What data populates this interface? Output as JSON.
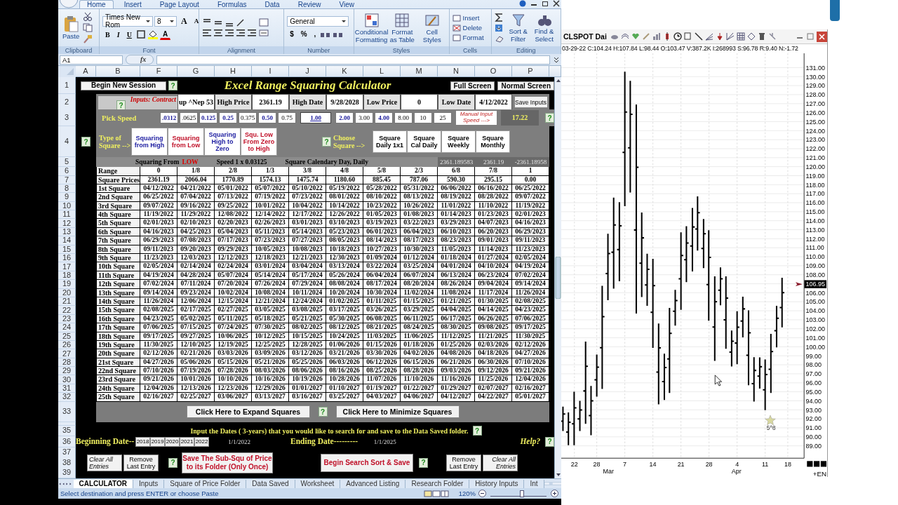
{
  "ribbon": {
    "tabs": [
      {
        "label": "Home",
        "selected": true
      },
      {
        "label": "Insert",
        "selected": false
      },
      {
        "label": "Page Layout",
        "selected": false
      },
      {
        "label": "Formulas",
        "selected": false
      },
      {
        "label": "Data",
        "selected": false
      },
      {
        "label": "Review",
        "selected": false
      },
      {
        "label": "View",
        "selected": false
      }
    ],
    "paste": "Paste",
    "font_name": "Times New Rom",
    "font_size": "8",
    "size_buttons": [
      "A",
      "A"
    ],
    "format_buttons": [
      "B",
      "I",
      "U"
    ],
    "font_color": "A",
    "number_format": "General",
    "number_buttons": [
      "$",
      "%",
      ","
    ],
    "styles": [
      "Conditional Formatting",
      "Format as Table",
      "Cell Styles"
    ],
    "cells": [
      "Insert",
      "Delete",
      "Format"
    ],
    "editing": [
      "Sort & Filter",
      "Find & Select"
    ],
    "groups": [
      "Clipboard",
      "Font",
      "Alignment",
      "Number",
      "Styles",
      "Cells",
      "Editing"
    ]
  },
  "name_box": "A1",
  "formula_label": "fx",
  "columns": [
    "A",
    "B",
    "F",
    "G",
    "H",
    "I",
    "J",
    "K",
    "L",
    "M",
    "N",
    "O",
    "P"
  ],
  "row_numbers": [
    "1",
    "2",
    "3",
    "4",
    "5",
    "6",
    "7",
    "8",
    "9",
    "10",
    "11",
    "12",
    "13",
    "14",
    "15",
    "16",
    "17",
    "18",
    "19",
    "20",
    "21",
    "22",
    "23",
    "24",
    "25",
    "26",
    "27",
    "28",
    "29",
    "30",
    "31",
    "32",
    "33",
    "35",
    "36",
    "37",
    "38",
    "39"
  ],
  "calculator": {
    "begin_button": "Begin New Session",
    "begin_help": "?",
    "title": "Excel Range Squaring Calculator",
    "screen_buttons": [
      "Full Screen",
      "Normal Screen"
    ],
    "inputs_label": "Inputs: Contract",
    "inputs_help": "?",
    "contract": "up ^Nep 53",
    "inputs": [
      {
        "label": "High Price",
        "value": "2361.19"
      },
      {
        "label": "High Date",
        "value": "9/28/2028"
      },
      {
        "label": "Low Price",
        "value": "0"
      },
      {
        "label": "Low Date",
        "value": "4/12/2022"
      }
    ],
    "save_inputs": "Save Inputs",
    "pick_speed_label": "Pick Speed",
    "speeds": [
      {
        "value": ".0312",
        "highlight": true,
        "selected": false
      },
      {
        "value": ".0625",
        "highlight": false,
        "selected": false
      },
      {
        "value": "0.125",
        "highlight": true,
        "selected": false
      },
      {
        "value": "0.25",
        "highlight": true,
        "selected": false
      },
      {
        "value": "0.375",
        "highlight": false,
        "selected": false
      },
      {
        "value": "0.50",
        "highlight": true,
        "selected": false
      },
      {
        "value": "0.75",
        "highlight": false,
        "selected": false
      },
      {
        "value": "1.00",
        "highlight": true,
        "selected": true
      },
      {
        "value": "2.00",
        "highlight": true,
        "selected": false
      },
      {
        "value": "3.00",
        "highlight": false,
        "selected": false
      },
      {
        "value": "4.00",
        "highlight": true,
        "selected": false
      },
      {
        "value": "8.00",
        "highlight": false,
        "selected": false
      },
      {
        "value": "10",
        "highlight": false,
        "selected": false
      },
      {
        "value": "25",
        "highlight": false,
        "selected": false
      }
    ],
    "manual_speed": "Manual Input Speed --->",
    "speed_value": "17.22",
    "speed_help": "?",
    "type_help": "?",
    "type_label": "Type of Square -->",
    "square_types": [
      {
        "label": "Squaring from High",
        "color": "#1c1ca0"
      },
      {
        "label": "Squaring from Low",
        "color": "#c01028"
      },
      {
        "label": "Squaring High to Zero",
        "color": "#1c1ca0"
      },
      {
        "label": "Squ. Low From Zero to High",
        "color": "#c01028"
      }
    ],
    "choose_help": "?",
    "choose_label": "Choose Square -->",
    "square_periods": [
      "Square Daily 1x1",
      "Square Cal Daily",
      "Square Weekly",
      "Square Monthly"
    ],
    "squaring_from_label": "Squaring From",
    "squaring_from": "LOW",
    "speed_text": "Speed 1 x 0.03125",
    "square_mode": "Square Calendary Day, Daily",
    "summary_values": [
      "2361.189583",
      "2361.19",
      "-2361.18958"
    ],
    "table": {
      "range_label": "Range",
      "ranges": [
        "0",
        "1/8",
        "2/8",
        "1/3",
        "3/8",
        "4/8",
        "5/8",
        "2/3",
        "6/8",
        "7/8",
        "1"
      ],
      "prices_label": "Square Prices",
      "prices": [
        "2361.19",
        "2066.04",
        "1770.89",
        "1574.13",
        "1475.74",
        "1180.60",
        "885.45",
        "787.06",
        "590.30",
        "295.15",
        "0.00"
      ],
      "rows": [
        {
          "label": "1st Square",
          "dates": [
            "04/12/2022",
            "04/21/2022",
            "05/01/2022",
            "05/07/2022",
            "05/10/2022",
            "05/19/2022",
            "05/28/2022",
            "05/31/2022",
            "06/06/2022",
            "06/16/2022",
            "06/25/2022"
          ]
        },
        {
          "label": "2nd Square",
          "dates": [
            "06/25/2022",
            "07/04/2022",
            "07/13/2022",
            "07/19/2022",
            "07/23/2022",
            "08/01/2022",
            "08/10/2022",
            "08/13/2022",
            "08/19/2022",
            "08/28/2022",
            "09/07/2022"
          ]
        },
        {
          "label": "3rd Square",
          "dates": [
            "09/07/2022",
            "09/16/2022",
            "09/25/2022",
            "10/01/2022",
            "10/04/2022",
            "10/14/2022",
            "10/23/2022",
            "10/26/2022",
            "11/01/2022",
            "11/10/2022",
            "11/19/2022"
          ]
        },
        {
          "label": "4th Square",
          "dates": [
            "11/19/2022",
            "11/29/2022",
            "12/08/2022",
            "12/14/2022",
            "12/17/2022",
            "12/26/2022",
            "01/05/2023",
            "01/08/2023",
            "01/14/2023",
            "01/23/2023",
            "02/01/2023"
          ]
        },
        {
          "label": "5th Square",
          "dates": [
            "02/01/2023",
            "02/10/2023",
            "02/20/2023",
            "02/26/2023",
            "03/01/2023",
            "03/10/2023",
            "03/19/2023",
            "03/22/2023",
            "03/29/2023",
            "04/07/2023",
            "04/16/2023"
          ]
        },
        {
          "label": "6th Square",
          "dates": [
            "04/16/2023",
            "04/25/2023",
            "05/04/2023",
            "05/11/2023",
            "05/14/2023",
            "05/23/2023",
            "06/01/2023",
            "06/04/2023",
            "06/10/2023",
            "06/20/2023",
            "06/29/2023"
          ]
        },
        {
          "label": "7th Square",
          "dates": [
            "06/29/2023",
            "07/08/2023",
            "07/17/2023",
            "07/23/2023",
            "07/27/2023",
            "08/05/2023",
            "08/14/2023",
            "08/17/2023",
            "08/23/2023",
            "09/01/2023",
            "09/11/2023"
          ]
        },
        {
          "label": "8th Square",
          "dates": [
            "09/11/2023",
            "09/20/2023",
            "09/29/2023",
            "10/05/2023",
            "10/08/2023",
            "10/18/2023",
            "10/27/2023",
            "10/30/2023",
            "11/05/2023",
            "11/14/2023",
            "11/23/2023"
          ]
        },
        {
          "label": "9th Square",
          "dates": [
            "11/23/2023",
            "12/03/2023",
            "12/12/2023",
            "12/18/2023",
            "12/21/2023",
            "12/30/2023",
            "01/09/2024",
            "01/12/2024",
            "01/18/2024",
            "01/27/2024",
            "02/05/2024"
          ]
        },
        {
          "label": "10th Square",
          "dates": [
            "02/05/2024",
            "02/14/2024",
            "02/24/2024",
            "03/01/2024",
            "03/04/2024",
            "03/13/2024",
            "03/22/2024",
            "03/25/2024",
            "04/01/2024",
            "04/10/2024",
            "04/19/2024"
          ]
        },
        {
          "label": "11th Square",
          "dates": [
            "04/19/2024",
            "04/28/2024",
            "05/07/2024",
            "05/14/2024",
            "05/17/2024",
            "05/26/2024",
            "06/04/2024",
            "06/07/2024",
            "06/13/2024",
            "06/23/2024",
            "07/02/2024"
          ]
        },
        {
          "label": "12th Square",
          "dates": [
            "07/02/2024",
            "07/11/2024",
            "07/20/2024",
            "07/26/2024",
            "07/29/2024",
            "08/08/2024",
            "08/17/2024",
            "08/20/2024",
            "08/26/2024",
            "09/04/2024",
            "09/14/2024"
          ]
        },
        {
          "label": "13th Square",
          "dates": [
            "09/14/2024",
            "09/23/2024",
            "10/02/2024",
            "10/08/2024",
            "10/11/2024",
            "10/20/2024",
            "10/30/2024",
            "11/02/2024",
            "11/08/2024",
            "11/17/2024",
            "11/26/2024"
          ]
        },
        {
          "label": "14th Square",
          "dates": [
            "11/26/2024",
            "12/06/2024",
            "12/15/2024",
            "12/21/2024",
            "12/24/2024",
            "01/02/2025",
            "01/11/2025",
            "01/15/2025",
            "01/21/2025",
            "01/30/2025",
            "02/08/2025"
          ]
        },
        {
          "label": "15th Square",
          "dates": [
            "02/08/2025",
            "02/17/2025",
            "02/27/2025",
            "03/05/2025",
            "03/08/2025",
            "03/17/2025",
            "03/26/2025",
            "03/29/2025",
            "04/04/2025",
            "04/14/2025",
            "04/23/2025"
          ]
        },
        {
          "label": "16th Square",
          "dates": [
            "04/23/2025",
            "05/02/2025",
            "05/11/2025",
            "05/18/2025",
            "05/21/2025",
            "05/30/2025",
            "06/08/2025",
            "06/11/2025",
            "06/17/2025",
            "06/26/2025",
            "07/06/2025"
          ]
        },
        {
          "label": "17th Square",
          "dates": [
            "07/06/2025",
            "07/15/2025",
            "07/24/2025",
            "07/30/2025",
            "08/02/2025",
            "08/12/2025",
            "08/21/2025",
            "08/24/2025",
            "08/30/2025",
            "09/08/2025",
            "09/17/2025"
          ]
        },
        {
          "label": "18th Square",
          "dates": [
            "09/17/2025",
            "09/27/2025",
            "10/06/2025",
            "10/12/2025",
            "10/15/2025",
            "10/24/2025",
            "11/03/2025",
            "11/06/2025",
            "11/12/2025",
            "11/21/2025",
            "11/30/2025"
          ]
        },
        {
          "label": "19th Square",
          "dates": [
            "11/30/2025",
            "12/10/2025",
            "12/19/2025",
            "12/25/2025",
            "12/28/2025",
            "01/06/2026",
            "01/15/2026",
            "01/18/2026",
            "01/25/2026",
            "02/03/2026",
            "02/12/2026"
          ]
        },
        {
          "label": "20th Square",
          "dates": [
            "02/12/2026",
            "02/21/2026",
            "03/03/2026",
            "03/09/2026",
            "03/12/2026",
            "03/21/2026",
            "03/30/2026",
            "04/02/2026",
            "04/08/2026",
            "04/18/2026",
            "04/27/2026"
          ]
        },
        {
          "label": "21st Square",
          "dates": [
            "04/27/2026",
            "05/06/2026",
            "05/15/2026",
            "05/21/2026",
            "05/25/2026",
            "06/03/2026",
            "06/12/2026",
            "06/15/2026",
            "06/21/2026",
            "06/30/2026",
            "07/10/2026"
          ]
        },
        {
          "label": "22nd Square",
          "dates": [
            "07/10/2026",
            "07/19/2026",
            "07/28/2026",
            "08/03/2026",
            "08/06/2026",
            "08/16/2026",
            "08/25/2026",
            "08/28/2026",
            "09/03/2026",
            "09/12/2026",
            "09/21/2026"
          ]
        },
        {
          "label": "23rd Square",
          "dates": [
            "09/21/2026",
            "10/01/2026",
            "10/10/2026",
            "10/16/2026",
            "10/19/2026",
            "10/28/2026",
            "11/07/2026",
            "11/10/2026",
            "11/16/2026",
            "11/25/2026",
            "12/04/2026"
          ]
        },
        {
          "label": "24th Square",
          "dates": [
            "12/04/2026",
            "12/13/2026",
            "12/23/2026",
            "12/29/2026",
            "01/01/2027",
            "01/10/2027",
            "01/19/2027",
            "01/22/2027",
            "01/29/2027",
            "02/07/2027",
            "02/16/2027"
          ]
        },
        {
          "label": "25th Square",
          "dates": [
            "02/16/2027",
            "02/25/2027",
            "03/06/2027",
            "03/13/2027",
            "03/16/2027",
            "03/25/2027",
            "04/03/2027",
            "04/06/2027",
            "04/12/2027",
            "04/22/2027",
            "05/01/2027"
          ]
        }
      ]
    },
    "expand_button": "Click Here to Expand Squares",
    "expand_help": "?",
    "minimize_button": "Click Here to Minimize Squares",
    "dates_prompt": "Input the Dates ( 3-years) that you would like to search for and save to the Data Saved folder.",
    "prompt_help": "?",
    "beginning_label": "Beginning Date--",
    "years": [
      "2018",
      "2019",
      "2020",
      "2021",
      "2022"
    ],
    "beginning_date": "1/1/2022",
    "ending_label": "Ending Date---------",
    "ending_date": "1/1/2025",
    "help_label": "Help?",
    "help_mark": "?",
    "left_actions": [
      "Clear All Entries",
      "Remove Last Entry"
    ],
    "left_help": "?",
    "save_subsquare": "Save The Sub-Squ of Price to its Folder (Only Once)",
    "begin_search": "Begin Search Sort & Save",
    "search_help": "?",
    "right_actions": [
      "Remove Last Entry",
      "Clear All Entries"
    ]
  },
  "sheet_tabs": [
    {
      "label": "CALCULATOR",
      "selected": true
    },
    {
      "label": "Inputs",
      "selected": false
    },
    {
      "label": "Square of Price Folder",
      "selected": false
    },
    {
      "label": "Data Saved",
      "selected": false
    },
    {
      "label": "Worksheet",
      "selected": false
    },
    {
      "label": "Advanced Listing",
      "selected": false
    },
    {
      "label": "Research Folder",
      "selected": false
    },
    {
      "label": "History Inputs",
      "selected": false
    },
    {
      "label": "Int",
      "selected": false
    }
  ],
  "status": "Select destination and press ENTER or choose Paste",
  "zoom": {
    "label": "120%",
    "level": 0.56
  },
  "chart": {
    "symbol": "CLSPOT Dai",
    "info": "03-29-22 C:104.24 H:107.84 L:98.44 O:103.47 V:387.2K I:268993 S:96.78 R:9.40 N:-1.72",
    "price_labels": [
      "131.00",
      "130.00",
      "129.00",
      "128.00",
      "127.00",
      "126.00",
      "125.00",
      "124.00",
      "123.00",
      "122.00",
      "121.00",
      "120.00",
      "119.00",
      "118.00",
      "117.00",
      "116.00",
      "115.00",
      "114.00",
      "113.00",
      "112.00",
      "111.00",
      "110.00",
      "109.00",
      "108.00",
      "106.00",
      "105.00",
      "104.00",
      "103.00",
      "102.00",
      "101.00",
      "100.00",
      "99.00",
      "98.00",
      "97.00",
      "96.00",
      "95.00",
      "94.00",
      "93.00",
      "92.00",
      "91.00",
      "90.00",
      "89.00"
    ],
    "last_price": "106.95",
    "day_labels": [
      "22",
      "28",
      "7",
      "14",
      "21",
      "28",
      "4",
      "11",
      "18"
    ],
    "month_labels": [
      "Mar",
      "Apr"
    ],
    "marker_label": "5^8",
    "corner_label": "+EN"
  }
}
